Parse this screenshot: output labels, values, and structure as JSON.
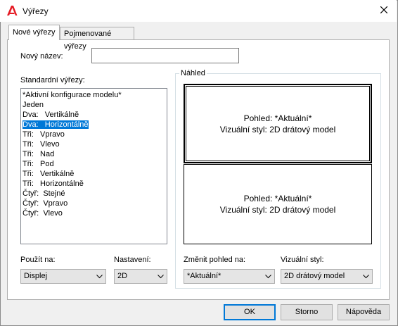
{
  "window": {
    "title": "Výřezy",
    "app_icon": "autocad-logo-icon",
    "close_icon": "close-icon"
  },
  "tabs": [
    {
      "label": "Nové výřezy",
      "active": true
    },
    {
      "label": "Pojmenované výřezy",
      "active": false
    }
  ],
  "new_name": {
    "label": "Nový název:",
    "value": ""
  },
  "standard": {
    "label": "Standardní výřezy:",
    "items": [
      "*Aktivní konfigurace modelu*",
      "Jeden",
      "Dva:   Vertikálně",
      "Dva:   Horizontálně",
      "Tři:   Vpravo",
      "Tři:   Vlevo",
      "Tři:   Nad",
      "Tři:   Pod",
      "Tři:   Vertikálně",
      "Tři:   Horizontálně",
      "Čtyř:  Stejné",
      "Čtyř:  Vpravo",
      "Čtyř:  Vlevo"
    ],
    "selected_index": 3
  },
  "preview": {
    "label": "Náhled",
    "viewports": [
      {
        "line1": "Pohled: *Aktuální*",
        "line2": "Vizuální styl: 2D drátový model",
        "active": true
      },
      {
        "line1": "Pohled: *Aktuální*",
        "line2": "Vizuální styl: 2D drátový model",
        "active": false
      }
    ]
  },
  "apply_to": {
    "label": "Použít na:",
    "value": "Displej"
  },
  "setup": {
    "label": "Nastavení:",
    "value": "2D"
  },
  "change_view": {
    "label": "Změnit pohled na:",
    "value": "*Aktuální*"
  },
  "visual_style": {
    "label": "Vizuální styl:",
    "value": "2D drátový model"
  },
  "buttons": {
    "ok": "OK",
    "cancel": "Storno",
    "help": "Nápověda"
  },
  "colors": {
    "selection": "#0078d7",
    "logo_red": "#e51b24"
  }
}
